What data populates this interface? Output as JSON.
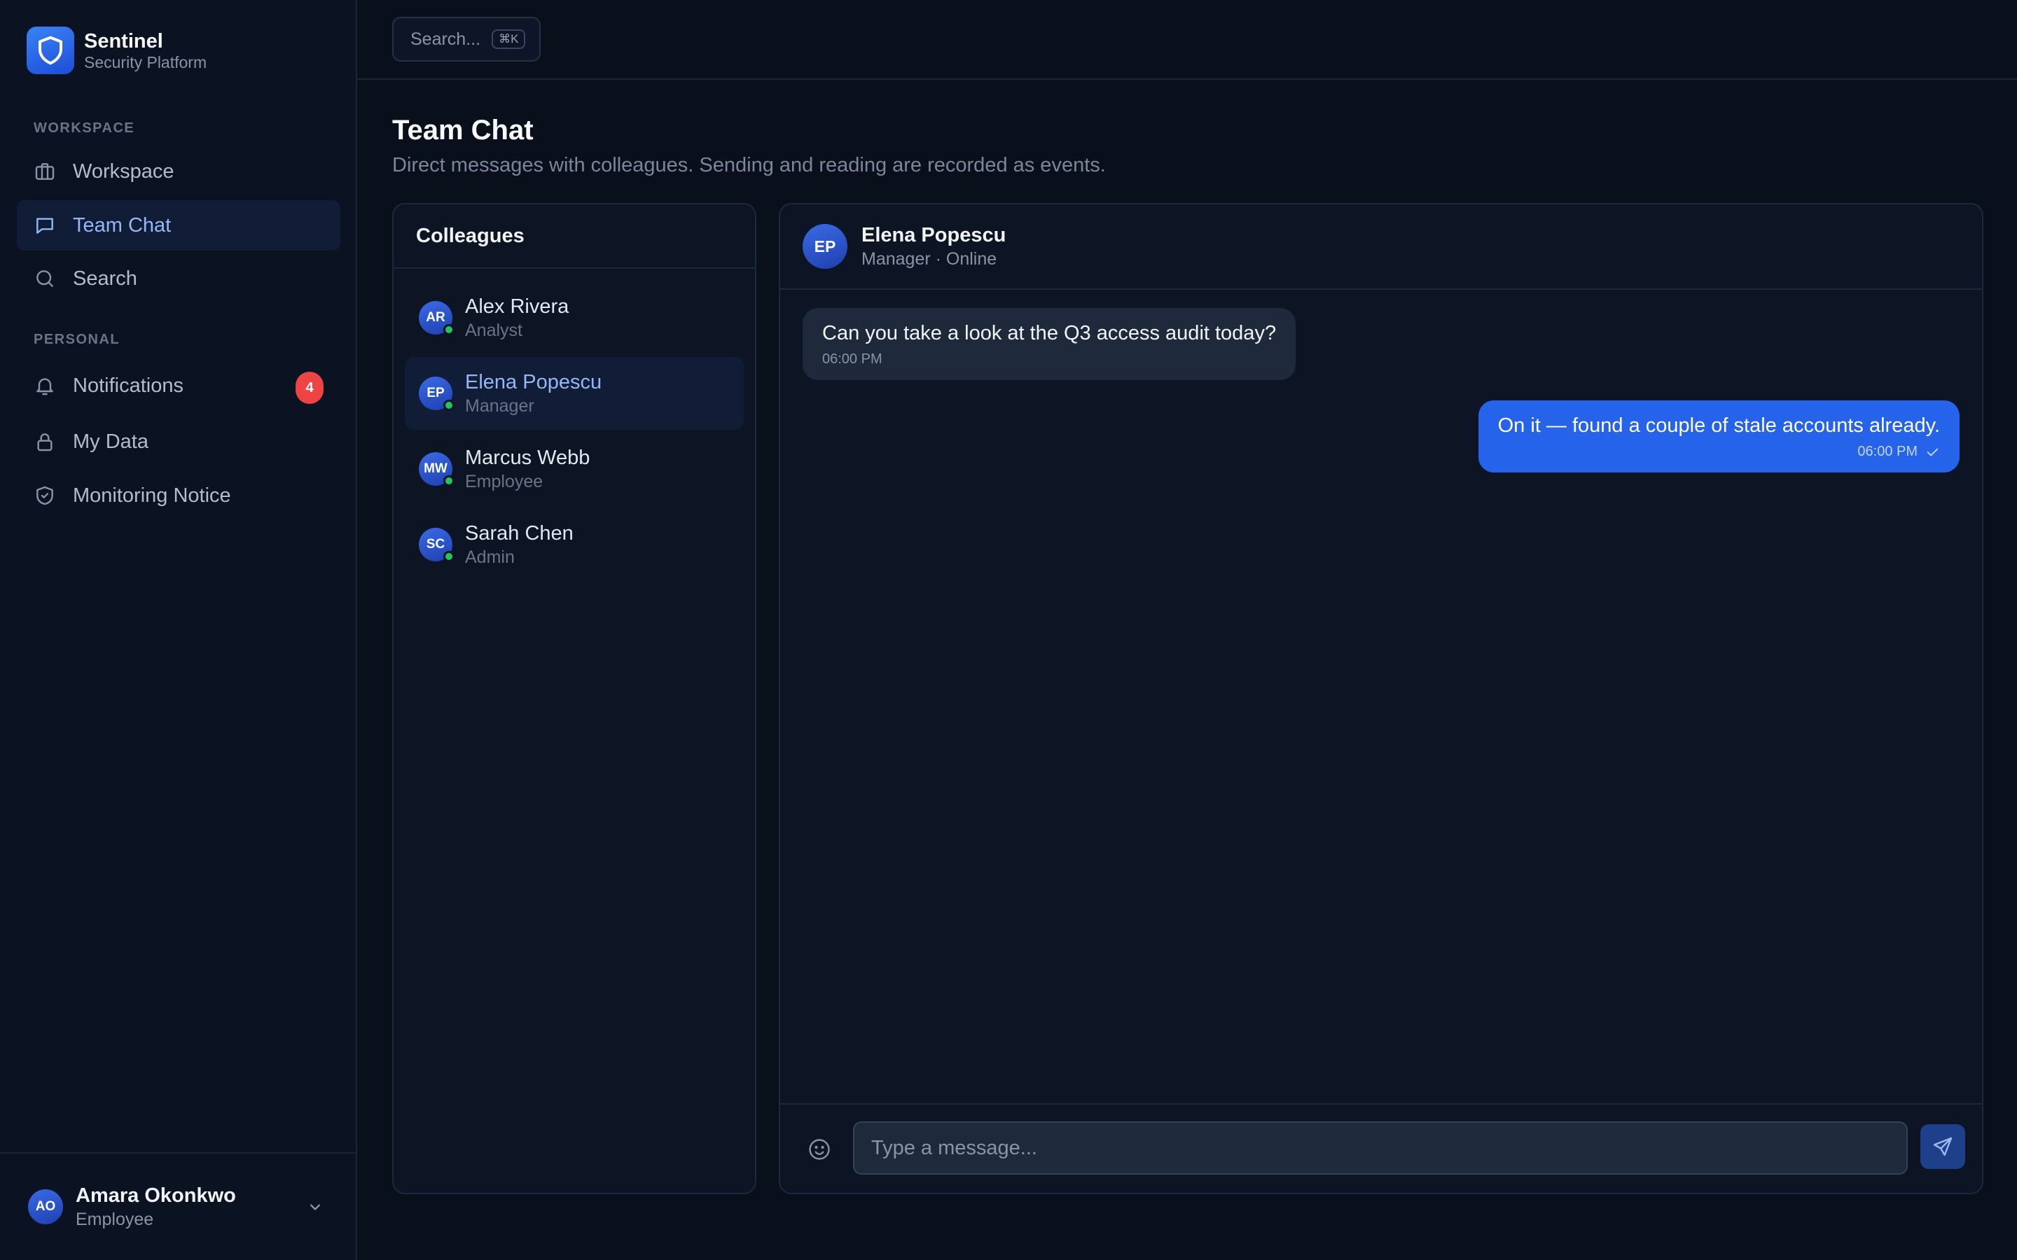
{
  "brand": {
    "name": "Sentinel",
    "subtitle": "Security Platform"
  },
  "sidebar": {
    "sections": [
      {
        "label": "WORKSPACE"
      },
      {
        "label": "PERSONAL"
      }
    ],
    "items": [
      {
        "label": "Workspace",
        "icon": "briefcase-icon"
      },
      {
        "label": "Team Chat",
        "icon": "chat-icon",
        "active": true
      },
      {
        "label": "Search",
        "icon": "search-icon"
      },
      {
        "label": "Notifications",
        "icon": "bell-icon",
        "badge": "4"
      },
      {
        "label": "My Data",
        "icon": "lock-icon"
      },
      {
        "label": "Monitoring Notice",
        "icon": "shield-check-icon"
      }
    ]
  },
  "user": {
    "initials": "AO",
    "name": "Amara Okonkwo",
    "role": "Employee"
  },
  "topbar": {
    "search_placeholder": "Search...",
    "shortcut": "⌘K"
  },
  "page": {
    "title": "Team Chat",
    "subtitle": "Direct messages with colleagues. Sending and reading are recorded as events."
  },
  "colleagues": {
    "title": "Colleagues",
    "items": [
      {
        "initials": "AR",
        "name": "Alex Rivera",
        "role": "Analyst"
      },
      {
        "initials": "EP",
        "name": "Elena Popescu",
        "role": "Manager",
        "active": true
      },
      {
        "initials": "MW",
        "name": "Marcus Webb",
        "role": "Employee"
      },
      {
        "initials": "SC",
        "name": "Sarah Chen",
        "role": "Admin"
      }
    ]
  },
  "chat": {
    "peer": {
      "initials": "EP",
      "name": "Elena Popescu",
      "status": "Manager · Online"
    },
    "messages": [
      {
        "direction": "in",
        "text": "Can you take a look at the Q3 access audit today?",
        "time": "06:00 PM"
      },
      {
        "direction": "out",
        "text": "On it — found a couple of stale accounts already.",
        "time": "06:00 PM"
      }
    ],
    "input_placeholder": "Type a message..."
  },
  "colors": {
    "accent": "#2563eb",
    "badge": "#ef4444",
    "online": "#22c55e",
    "background": "#0a0f1c"
  }
}
